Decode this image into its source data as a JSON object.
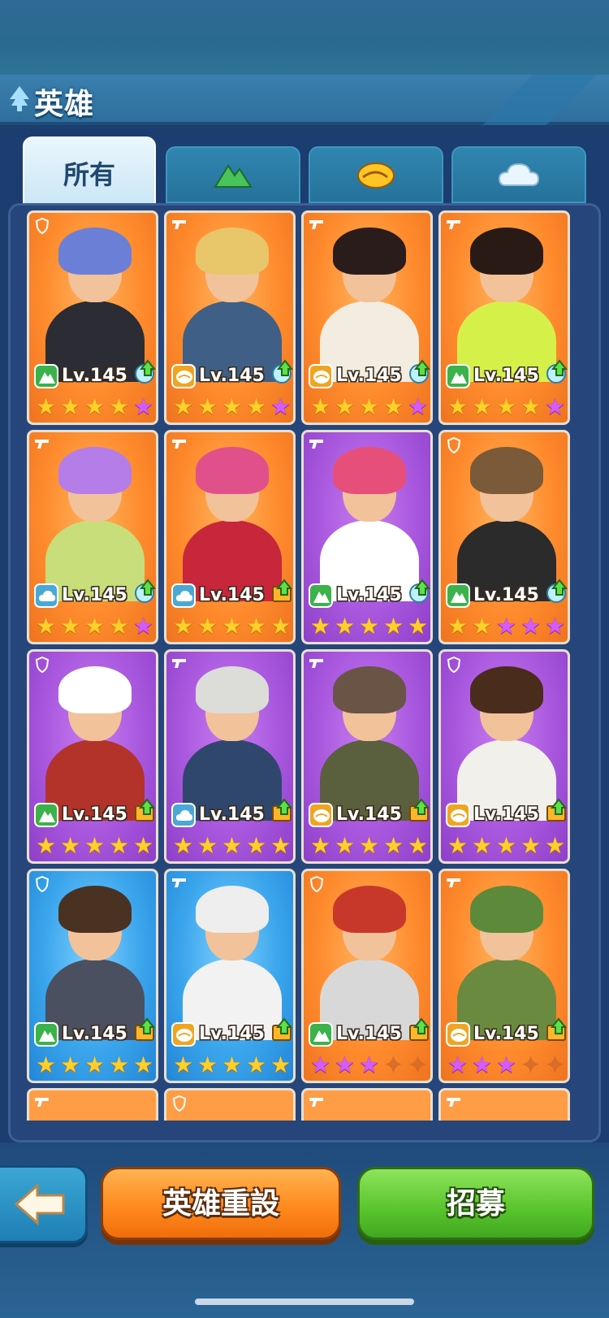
{
  "header": {
    "title": "英雄"
  },
  "tabs": [
    {
      "label": "所有",
      "icon": "all",
      "active": true
    },
    {
      "label": "",
      "icon": "mountain-element-icon",
      "active": false
    },
    {
      "label": "",
      "icon": "sand-element-icon",
      "active": false
    },
    {
      "label": "",
      "icon": "cloud-element-icon",
      "active": false
    }
  ],
  "colors": {
    "orange_card": "#ff8b2d",
    "purple_card": "#a857de",
    "blue_card": "#3aa5ec",
    "mountain": "#3bb24a",
    "sand": "#f0a520",
    "cloud": "#4aa8d6"
  },
  "heroes": [
    {
      "level": "Lv.145",
      "element": "mountain",
      "bg": "orange",
      "role": "shield-icon",
      "upgrade": "element-up-icon",
      "stars": [
        "gold",
        "gold",
        "gold",
        "gold",
        "pink"
      ],
      "hair": "#6c7fd6",
      "outfit": "#2c2c34"
    },
    {
      "level": "Lv.145",
      "element": "sand",
      "bg": "orange",
      "role": "gun-icon",
      "upgrade": "element-up-icon",
      "stars": [
        "gold",
        "gold",
        "gold",
        "gold",
        "pink"
      ],
      "hair": "#e8c66a",
      "outfit": "#3f5f86"
    },
    {
      "level": "Lv.145",
      "element": "sand",
      "bg": "orange",
      "role": "gun-icon",
      "upgrade": "element-up-icon",
      "stars": [
        "gold",
        "gold",
        "gold",
        "gold",
        "pink"
      ],
      "hair": "#2b1c1c",
      "outfit": "#f3ece0"
    },
    {
      "level": "Lv.145",
      "element": "mountain",
      "bg": "orange",
      "role": "gun-icon",
      "upgrade": "element-up-icon",
      "stars": [
        "gold",
        "gold",
        "gold",
        "gold",
        "pink"
      ],
      "hair": "#2a1a16",
      "outfit": "#d6f04a"
    },
    {
      "level": "Lv.145",
      "element": "cloud",
      "bg": "orange",
      "role": "gun-icon",
      "upgrade": "element-up-icon",
      "stars": [
        "gold",
        "gold",
        "gold",
        "gold",
        "pink"
      ],
      "hair": "#b57de8",
      "outfit": "#c7de7a"
    },
    {
      "level": "Lv.145",
      "element": "cloud",
      "bg": "orange",
      "role": "gun-icon",
      "upgrade": "book-up-icon",
      "stars": [
        "gold",
        "gold",
        "gold",
        "gold",
        "gold"
      ],
      "hair": "#e0508a",
      "outfit": "#c8263a"
    },
    {
      "level": "Lv.145",
      "element": "mountain",
      "bg": "purple",
      "role": "gun-icon",
      "upgrade": "element-up-icon",
      "stars": [
        "gold",
        "gold",
        "gold",
        "gold",
        "gold"
      ],
      "hair": "#e64f7a",
      "outfit": "#ffffff"
    },
    {
      "level": "Lv.145",
      "element": "mountain",
      "bg": "orange",
      "role": "shield-icon",
      "upgrade": "element-up-icon",
      "stars": [
        "gold",
        "gold",
        "pink",
        "pink",
        "pink"
      ],
      "hair": "#7a5a38",
      "outfit": "#2b2b2b"
    },
    {
      "level": "Lv.145",
      "element": "mountain",
      "bg": "purple",
      "role": "shield-icon",
      "upgrade": "book-up-icon",
      "stars": [
        "gold",
        "gold",
        "gold",
        "gold",
        "gold"
      ],
      "hair": "#ffffff",
      "outfit": "#b3332a"
    },
    {
      "level": "Lv.145",
      "element": "cloud",
      "bg": "purple",
      "role": "gun-icon",
      "upgrade": "book-up-icon",
      "stars": [
        "gold",
        "gold",
        "gold",
        "gold",
        "gold"
      ],
      "hair": "#dcdcd8",
      "outfit": "#2f466d"
    },
    {
      "level": "Lv.145",
      "element": "sand",
      "bg": "purple",
      "role": "gun-icon",
      "upgrade": "book-up-icon",
      "stars": [
        "gold",
        "gold",
        "gold",
        "gold",
        "gold"
      ],
      "hair": "#6a5446",
      "outfit": "#5a5f3d"
    },
    {
      "level": "Lv.145",
      "element": "sand",
      "bg": "purple",
      "role": "shield-icon",
      "upgrade": "book-up-icon",
      "stars": [
        "gold",
        "gold",
        "gold",
        "gold",
        "gold"
      ],
      "hair": "#4a2c1c",
      "outfit": "#f2f0ea"
    },
    {
      "level": "Lv.145",
      "element": "mountain",
      "bg": "blue",
      "role": "shield-icon",
      "upgrade": "book-up-icon",
      "stars": [
        "gold",
        "gold",
        "gold",
        "gold",
        "gold"
      ],
      "hair": "#4a3222",
      "outfit": "#4a5060"
    },
    {
      "level": "Lv.145",
      "element": "sand",
      "bg": "blue",
      "role": "gun-icon",
      "upgrade": "book-up-icon",
      "stars": [
        "gold",
        "gold",
        "gold",
        "gold",
        "gold"
      ],
      "hair": "#eeeeee",
      "outfit": "#f2f2f2"
    },
    {
      "level": "Lv.145",
      "element": "mountain",
      "bg": "orange",
      "role": "shield-icon",
      "upgrade": "book-up-icon",
      "stars": [
        "pink",
        "pink",
        "pink",
        "empty",
        "empty"
      ],
      "hair": "#c8382a",
      "outfit": "#d8d8d8"
    },
    {
      "level": "Lv.145",
      "element": "sand",
      "bg": "orange",
      "role": "gun-icon",
      "upgrade": "book-up-icon",
      "stars": [
        "pink",
        "pink",
        "pink",
        "empty",
        "empty"
      ],
      "hair": "#5d8a3a",
      "outfit": "#6a8a40"
    }
  ],
  "peek_row_roles": [
    "gun-icon",
    "shield-icon",
    "gun-icon",
    "gun-icon"
  ],
  "footer": {
    "back_icon": "arrow-left-icon",
    "reset_label": "英雄重設",
    "recruit_label": "招募"
  }
}
